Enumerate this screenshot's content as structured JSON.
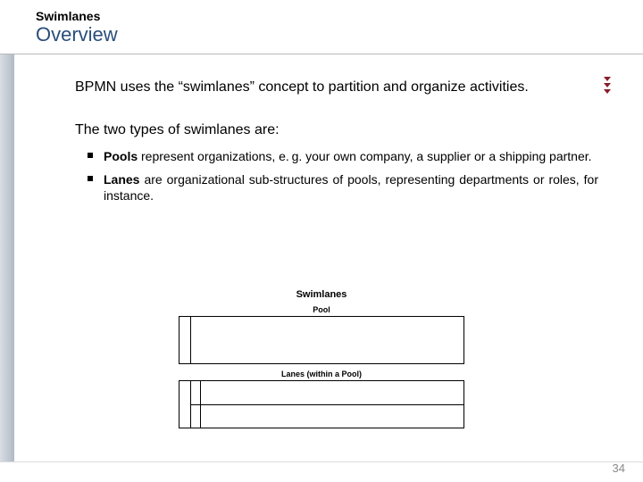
{
  "header": {
    "kicker": "Swimlanes",
    "title": "Overview"
  },
  "bullets": [
    {
      "text": "BPMN uses the “swimlanes” concept to partition and organize activities."
    },
    {
      "text": "The two types of swimlanes are:",
      "children": [
        {
          "bold": "Pools",
          "rest": " represent organizations, e. g. your own company, a supplier or a shipping partner."
        },
        {
          "bold": "Lanes",
          "rest": " are organizational sub-structures of pools, representing departments or roles, for instance."
        }
      ]
    }
  ],
  "diagram": {
    "title": "Swimlanes",
    "pool_label": "Pool",
    "lanes_label": "Lanes (within a Pool)"
  },
  "page_number": "34"
}
